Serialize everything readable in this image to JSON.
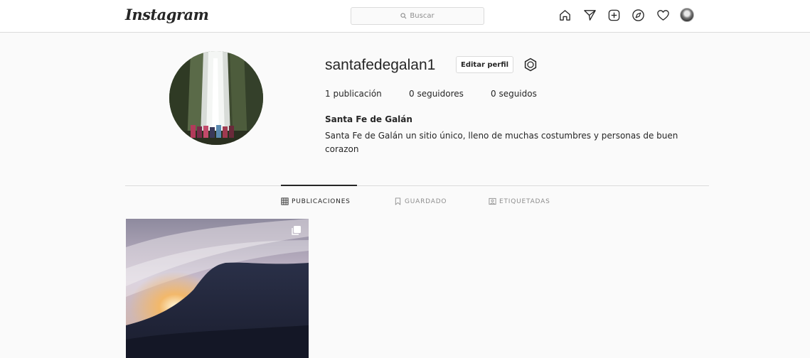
{
  "header": {
    "logo": "Instagram",
    "search_placeholder": "Buscar",
    "icons": [
      "home-icon",
      "direct-icon",
      "new-post-icon",
      "explore-icon",
      "activity-icon",
      "profile-avatar"
    ]
  },
  "profile": {
    "username": "santafedegalan1",
    "edit_label": "Editar perfil",
    "stats": {
      "posts": "1 publicación",
      "followers": "0 seguidores",
      "following": "0 seguidos"
    },
    "full_name": "Santa Fe de Galán",
    "bio": "Santa Fe de Galán un sitio único, lleno de muchas costumbres y personas de buen corazon"
  },
  "tabs": [
    {
      "label": "PUBLICACIONES",
      "active": true
    },
    {
      "label": "GUARDADO",
      "active": false
    },
    {
      "label": "ETIQUETADAS",
      "active": false
    }
  ],
  "colors": {
    "text": "#262626",
    "muted": "#8e8e8e",
    "border": "#dbdbdb",
    "background": "#fafafa"
  }
}
